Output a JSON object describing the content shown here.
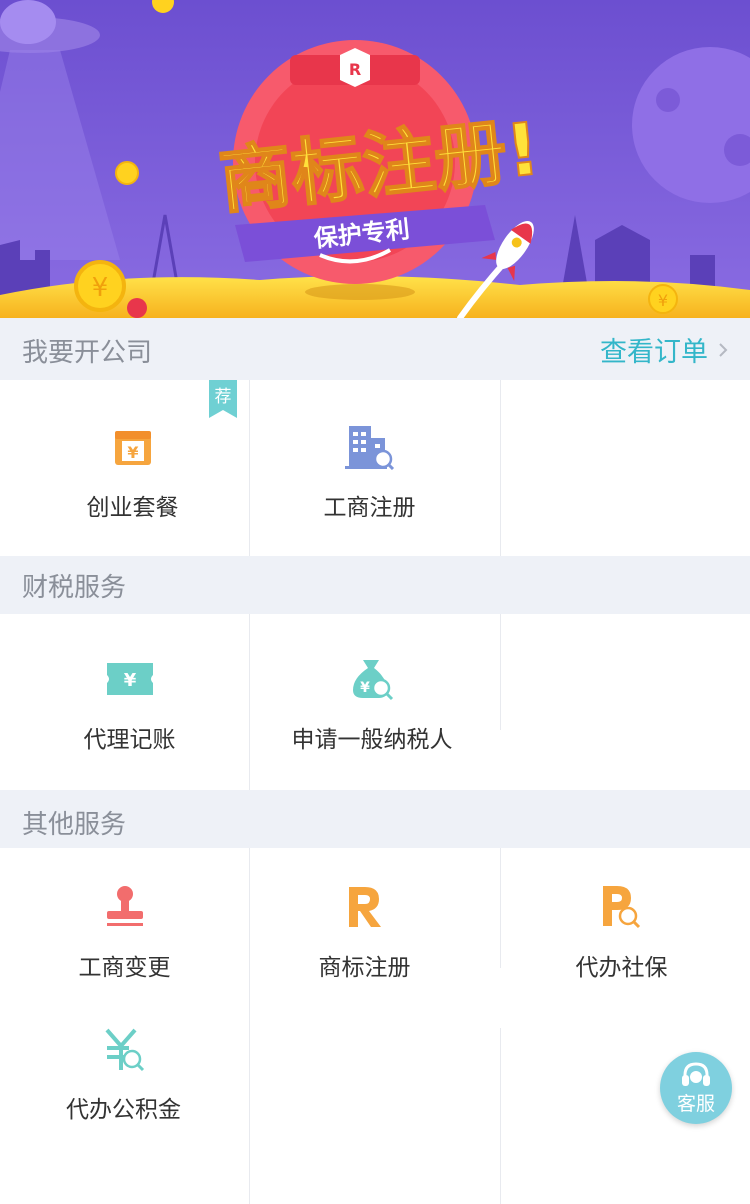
{
  "banner": {
    "headline": "商标注册!",
    "ribbon": "保护专利",
    "badge": "R"
  },
  "section_company": {
    "title": "我要开公司",
    "order_link": "查看订单",
    "items": [
      {
        "label": "创业套餐",
        "tag": "荐",
        "icon": "package-yen-icon"
      },
      {
        "label": "工商注册",
        "icon": "building-search-icon"
      }
    ]
  },
  "section_tax": {
    "title": "财税服务",
    "items": [
      {
        "label": "代理记账",
        "icon": "ticket-yen-icon"
      },
      {
        "label": "申请一般纳税人",
        "icon": "moneybag-search-icon"
      }
    ]
  },
  "section_other": {
    "title": "其他服务",
    "items": [
      {
        "label": "工商变更",
        "icon": "stamp-icon"
      },
      {
        "label": "商标注册",
        "icon": "trademark-r-icon"
      },
      {
        "label": "代办社保",
        "icon": "p-search-icon"
      },
      {
        "label": "代办公积金",
        "icon": "yen-search-icon"
      }
    ]
  },
  "customer_service": {
    "label": "客服",
    "icon": "headset-icon"
  },
  "colors": {
    "section_bg": "#eef1f7",
    "accent_teal": "#33b6c9",
    "orange": "#f6a53e",
    "teal_icon": "#6ccfc7",
    "red_icon": "#f26d6d",
    "blue_icon": "#6f8fd6",
    "banner_purple": "#7a5bd6"
  }
}
